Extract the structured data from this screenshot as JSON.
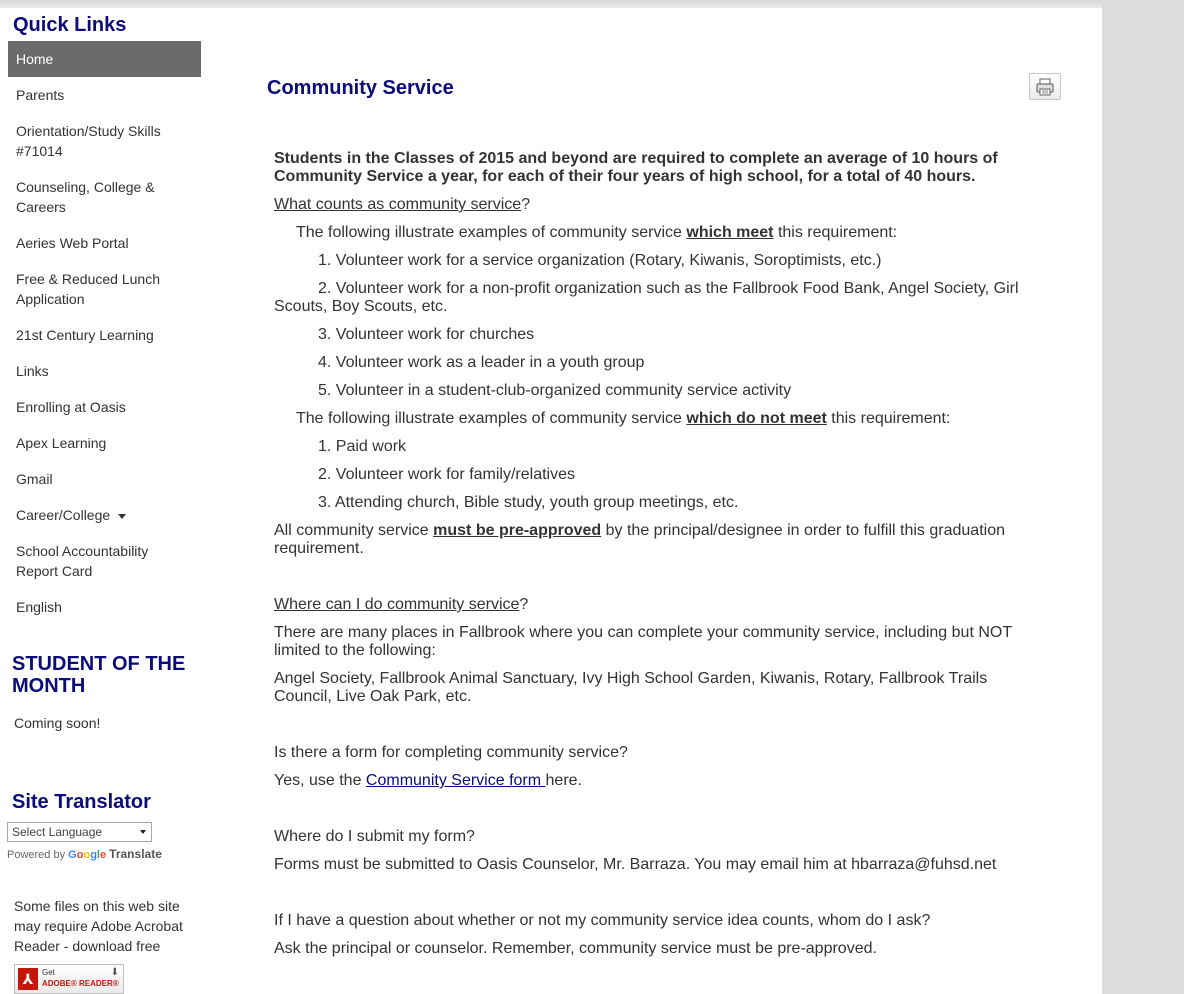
{
  "sidebar": {
    "quick_links_title": "Quick Links",
    "items": [
      {
        "label": "Home"
      },
      {
        "label": "Parents"
      },
      {
        "label": "Orientation/Study Skills #71014"
      },
      {
        "label": "Counseling, College & Careers"
      },
      {
        "label": "Aeries Web Portal"
      },
      {
        "label": "Free & Reduced Lunch Application"
      },
      {
        "label": "21st Century Learning"
      },
      {
        "label": "Links"
      },
      {
        "label": "Enrolling at Oasis"
      },
      {
        "label": "Apex Learning"
      },
      {
        "label": "Gmail"
      },
      {
        "label": "Career/College"
      },
      {
        "label": "School Accountability Report Card"
      },
      {
        "label": "English"
      }
    ],
    "student_of_month_title": "STUDENT OF THE MONTH",
    "student_of_month_text": "Coming soon!",
    "translator_title": "Site Translator",
    "select_language": "Select Language",
    "powered_by": "Powered by",
    "google": "Google",
    "translate": "Translate",
    "acrobat_text": "Some files on this web site may require Adobe Acrobat Reader - download free",
    "acrobat_badge": {
      "get": "Get",
      "reader": "ADOBE® READER®"
    }
  },
  "main": {
    "title": "Community Service",
    "lead": "Students in the Classes of 2015 and beyond are required to complete an average of 10 hours of Community Service a year, for each of their four years of high school, for a total of 40 hours.",
    "q1": "What counts as community service",
    "q_mark": "?",
    "meet_intro_pre": "The following illustrate examples of community service ",
    "meet_em": "which meet",
    "meet_post": " this requirement:",
    "meet_items": [
      "1.  Volunteer work for a service organization (Rotary, Kiwanis, Soroptimists, etc.)",
      "2.  Volunteer work for a non-profit organization such as the Fallbrook Food Bank, Angel Society, Girl Scouts, Boy Scouts, etc.",
      "3.  Volunteer work for churches",
      "4.  Volunteer work as a leader in a youth group",
      "5.  Volunteer in a student-club-organized community service activity"
    ],
    "notmeet_em": "which do not meet",
    "notmeet_items": [
      "1.  Paid work",
      "2.  Volunteer work for family/relatives",
      "3.  Attending church, Bible study, youth group meetings, etc."
    ],
    "preapproved_pre": "All community service ",
    "preapproved_em": "must be pre-approved",
    "preapproved_post": " by the principal/designee in order to fulfill this graduation requirement.",
    "q2": "Where can I do community service",
    "places_intro": "There are many places in Fallbrook where you can complete your community service, including but NOT limited to the following:",
    "places_list": "Angel Society, Fallbrook Animal Sanctuary, Ivy High School Garden, Kiwanis, Rotary, Fallbrook Trails Council, Live Oak Park, etc.",
    "q3": "Is there a form for completing community service?",
    "form_pre": "Yes, use the ",
    "form_link": "Community Service form ",
    "form_post": "here.",
    "q4": "Where do I submit my form?",
    "submit_text": "Forms must be submitted to Oasis Counselor, Mr. Barraza.  You may email him at hbarraza@fuhsd.net",
    "q5": "If I have a question about whether or not my community service idea counts, whom do I ask?",
    "ask_text": "Ask the principal or counselor.  Remember, community service must be pre-approved."
  }
}
